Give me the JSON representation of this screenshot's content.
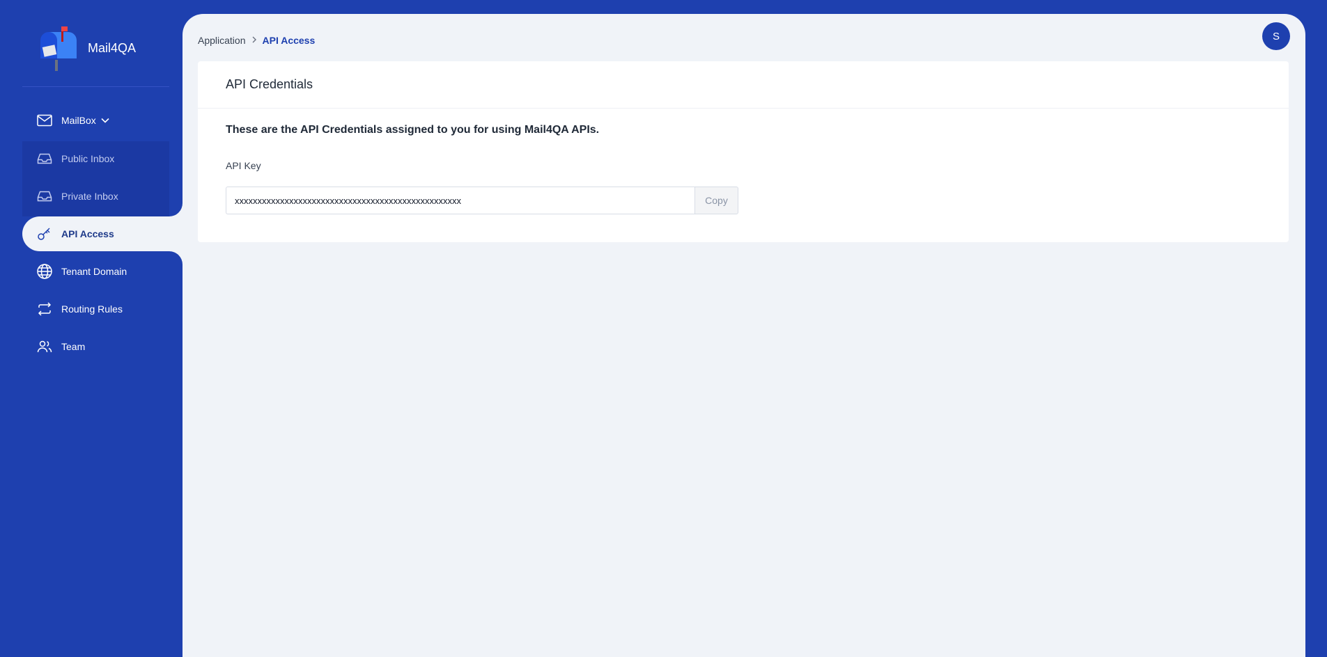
{
  "app": {
    "name": "Mail4QA"
  },
  "sidebar": {
    "items": [
      {
        "label": "MailBox",
        "icon": "mail-icon"
      },
      {
        "label": "Public Inbox",
        "icon": "inbox-icon"
      },
      {
        "label": "Private Inbox",
        "icon": "inbox-icon"
      },
      {
        "label": "API Access",
        "icon": "key-icon"
      },
      {
        "label": "Tenant Domain",
        "icon": "globe-icon"
      },
      {
        "label": "Routing Rules",
        "icon": "arrows-icon"
      },
      {
        "label": "Team",
        "icon": "users-icon"
      }
    ]
  },
  "breadcrumb": {
    "parent": "Application",
    "current": "API Access"
  },
  "user": {
    "avatar_initial": "S"
  },
  "card": {
    "title": "API Credentials",
    "intro": "These are the API Credentials assigned to you for using Mail4QA APIs.",
    "api_key_label": "API Key",
    "api_key_value": "xxxxxxxxxxxxxxxxxxxxxxxxxxxxxxxxxxxxxxxxxxxxxxxxxx",
    "copy_label": "Copy"
  },
  "colors": {
    "accent": "#1e40af",
    "background": "#f0f3f8"
  }
}
